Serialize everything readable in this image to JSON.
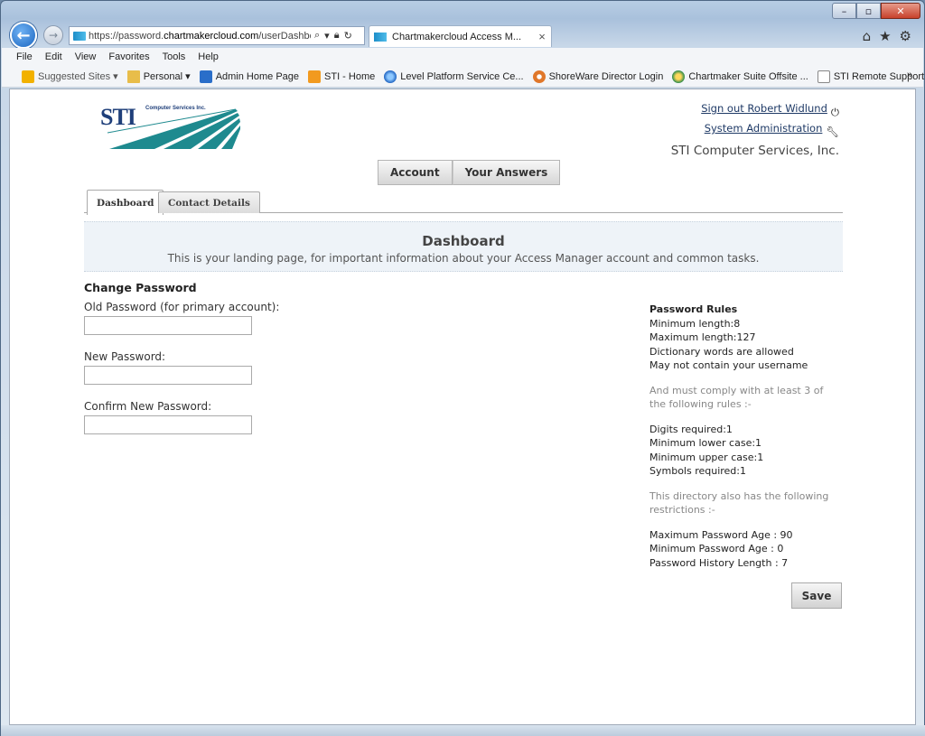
{
  "browser": {
    "address_url_prefix": "https://password.",
    "address_url_domain": "chartmakercloud.com",
    "address_url_rest": "/userDashbo",
    "tab_title": "Chartmakercloud Access M...",
    "tab_close": "×",
    "window_minimize": "–",
    "window_restore": "▫",
    "window_close": "✕"
  },
  "menu": [
    "File",
    "Edit",
    "View",
    "Favorites",
    "Tools",
    "Help"
  ],
  "favorites": [
    {
      "label": "Suggested Sites ▾",
      "icon": "bing-icon"
    },
    {
      "label": "Personal ▾",
      "icon": "folder-icon"
    },
    {
      "label": "Admin Home Page",
      "icon": "office-icon"
    },
    {
      "label": "STI - Home",
      "icon": "sti-icon"
    },
    {
      "label": "Level Platform Service Ce...",
      "icon": "ie-icon"
    },
    {
      "label": "ShoreWare Director Login",
      "icon": "shoreware-icon"
    },
    {
      "label": "Chartmaker Suite Offsite ...",
      "icon": "chartmaker-icon"
    },
    {
      "label": "STI Remote Support",
      "icon": "page-icon"
    }
  ],
  "header": {
    "logo_text": "STI",
    "logo_sub": "Computer Services Inc.",
    "sign_out": "Sign out Robert Widlund",
    "sys_admin": "System Administration",
    "company": "STI Computer Services, Inc."
  },
  "buttons": {
    "account": "Account",
    "your_answers": "Your Answers"
  },
  "tabs": {
    "dashboard": "Dashboard",
    "contact_details": "Contact Details"
  },
  "banner": {
    "title": "Dashboard",
    "subtitle": "This is your landing page, for important information about your Access Manager account and common tasks."
  },
  "form": {
    "heading": "Change Password",
    "old_label": "Old Password (for primary account):",
    "new_label": "New Password:",
    "confirm_label": "Confirm New Password:",
    "old_value": "",
    "new_value": "",
    "confirm_value": ""
  },
  "rules": {
    "title": "Password Rules",
    "min_len": "Minimum length:8",
    "max_len": "Maximum length:127",
    "dict": "Dictionary words are allowed",
    "no_user": "May not contain your username",
    "comply": "And must comply with at least 3 of the following rules :-",
    "digits": "Digits required:1",
    "lower": "Minimum lower case:1",
    "upper": "Minimum upper case:1",
    "symbols": "Symbols required:1",
    "restrict": "This directory also has the following restrictions :-",
    "max_age": "Maximum Password Age : 90",
    "min_age": "Minimum Password Age : 0",
    "history": "Password History Length : 7"
  },
  "save_label": "Save"
}
